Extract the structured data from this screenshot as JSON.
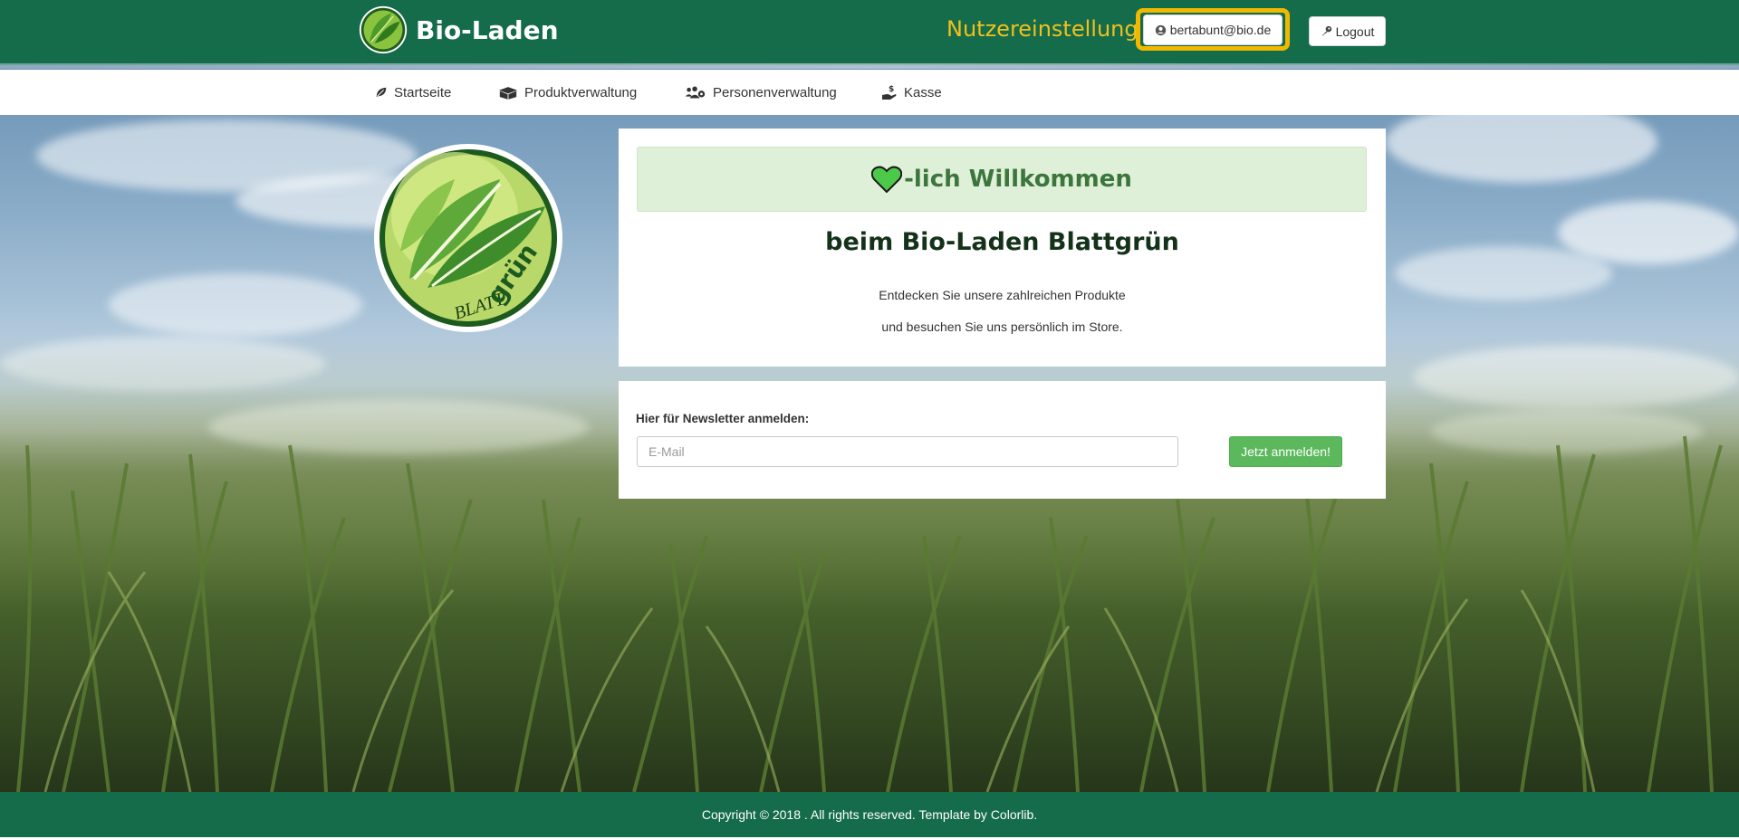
{
  "header": {
    "brand_name": "Bio-Laden",
    "user_settings_label": "Nutzereinstellung",
    "user_email": "bertabunt@bio.de",
    "logout_label": "Logout"
  },
  "nav": {
    "items": [
      {
        "label": "Startseite",
        "icon": "leaf-icon"
      },
      {
        "label": "Produktverwaltung",
        "icon": "boxes-icon"
      },
      {
        "label": "Personenverwaltung",
        "icon": "users-cog-icon"
      },
      {
        "label": "Kasse",
        "icon": "hand-dollar-icon"
      }
    ]
  },
  "logo": {
    "text_blatt": "BLATT",
    "text_gruen": "grün"
  },
  "welcome": {
    "banner_text": "-lich Willkommen",
    "title": "beim Bio-Laden Blattgrün",
    "line1": "Entdecken Sie unsere zahlreichen Produkte",
    "line2": "und besuchen Sie uns persönlich im Store."
  },
  "newsletter": {
    "label": "Hier für Newsletter anmelden:",
    "placeholder": "E-Mail",
    "value": "",
    "button_label": "Jetzt anmelden!"
  },
  "footer": {
    "text": "Copyright © 2018 . All rights reserved. Template by Colorlib."
  },
  "colors": {
    "header_green": "#146c4b",
    "highlight_yellow": "#f1b800",
    "banner_bg": "#dff0d8",
    "banner_text": "#3c763d",
    "button_green": "#5cb85c",
    "heart": "#4dc94a"
  }
}
